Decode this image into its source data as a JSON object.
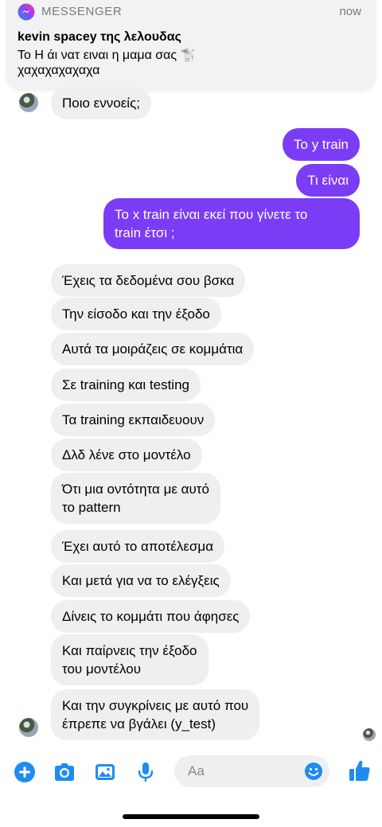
{
  "notification": {
    "app_name": "MESSENGER",
    "time": "now",
    "title": "kevin spacey της λελουδας",
    "line1": "Το Η άι νατ ειναι η μαμα σας 🐩",
    "line2": "χαχαχαχαχαχα"
  },
  "messages": [
    {
      "dir": "in",
      "text": "Ποιο εννοείς;"
    },
    {
      "dir": "out",
      "text": "Το y train"
    },
    {
      "dir": "out",
      "text": "Τι είναι"
    },
    {
      "dir": "out",
      "text": "Το x train είναι εκεί που γίνετε το\ntrain έτσι ;"
    },
    {
      "dir": "in",
      "text": "Έχεις τα δεδομένα σου βσκα"
    },
    {
      "dir": "in",
      "text": "Την είσοδο και την έξοδο"
    },
    {
      "dir": "in",
      "text": "Αυτά τα μοιράζεις σε κομμάτια"
    },
    {
      "dir": "in",
      "text": "Σε training και testing"
    },
    {
      "dir": "in",
      "text": "Τα training εκπαιδευουν"
    },
    {
      "dir": "in",
      "text": "Δλδ λένε στο μοντέλο"
    },
    {
      "dir": "in",
      "text": "Ότι μια οντότητα με αυτό\nτο pattern"
    },
    {
      "dir": "in",
      "text": "Έχει αυτό το αποτέλεσμα"
    },
    {
      "dir": "in",
      "text": "Και μετά για να το ελέγξεις"
    },
    {
      "dir": "in",
      "text": "Δίνεις το κομμάτι που άφησες"
    },
    {
      "dir": "in",
      "text": "Και παίρνεις την έξοδο\nτου μοντέλου"
    },
    {
      "dir": "in",
      "text": "Και την συγκρίνεις με αυτό που\nέπρεπε να βγάλει (y_test)"
    }
  ],
  "composer": {
    "placeholder": "Aa"
  },
  "icons": {
    "plus": "plus-icon",
    "camera": "camera-icon",
    "gallery": "image-icon",
    "mic": "microphone-icon",
    "emoji": "emoji-icon",
    "like": "thumbs-up-icon"
  },
  "colors": {
    "accent": "#7b3cf5",
    "blue": "#1e8cf0",
    "incoming_bubble": "#efeff1"
  }
}
